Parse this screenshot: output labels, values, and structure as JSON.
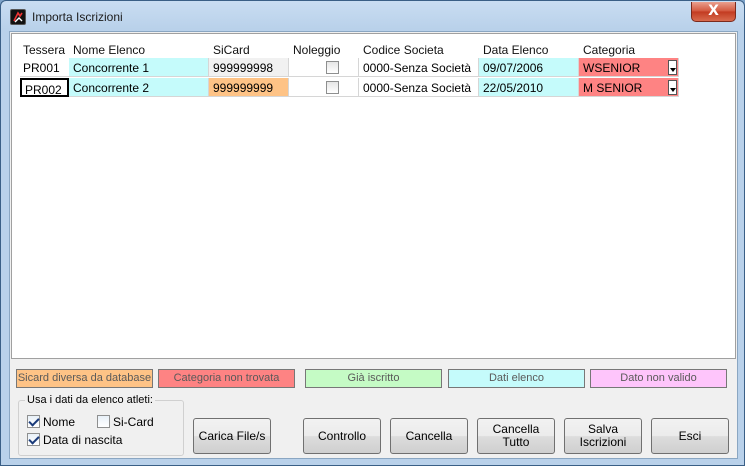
{
  "window": {
    "title": "Importa Iscrizioni",
    "close_label": "X"
  },
  "grid": {
    "columns": [
      "Tessera",
      "Nome Elenco",
      "SiCard",
      "Noleggio",
      "Codice Societa",
      "Data Elenco",
      "Categoria"
    ],
    "rows": [
      {
        "tessera": "PR001",
        "nome": "Concorrente 1",
        "sicard": "999999998",
        "noleggio": false,
        "codice": "0000-Senza Società",
        "data": "09/07/2006",
        "categoria": "WSENIOR"
      },
      {
        "tessera": "PR002",
        "nome": "Concorrente 2",
        "sicard": "999999999",
        "noleggio": false,
        "codice": "0000-Senza Società",
        "data": "22/05/2010",
        "categoria": "M SENIOR"
      }
    ]
  },
  "legend": {
    "sicard_diff": "Sicard diversa da database",
    "cat_missing": "Categoria non trovata",
    "already": "Già iscritto",
    "list_data": "Dati elenco",
    "invalid": "Dato non valido"
  },
  "options": {
    "title": "Usa i dati da elenco atleti:",
    "nome": {
      "label": "Nome",
      "checked": true
    },
    "sicard": {
      "label": "Si-Card",
      "checked": false
    },
    "nascita": {
      "label": "Data di nascita",
      "checked": true
    }
  },
  "buttons": {
    "carica": "Carica File/s",
    "controllo": "Controllo",
    "cancella": "Cancella",
    "cancella_tutto_1": "Cancella",
    "cancella_tutto_2": "Tutto",
    "salva_1": "Salva",
    "salva_2": "Iscrizioni",
    "esci": "Esci"
  },
  "colors": {
    "sicard_diff": "#fec386",
    "cat_missing": "#fe8383",
    "already": "#c5fbc5",
    "list_data": "#c5fbfb",
    "invalid": "#fec5fb"
  }
}
